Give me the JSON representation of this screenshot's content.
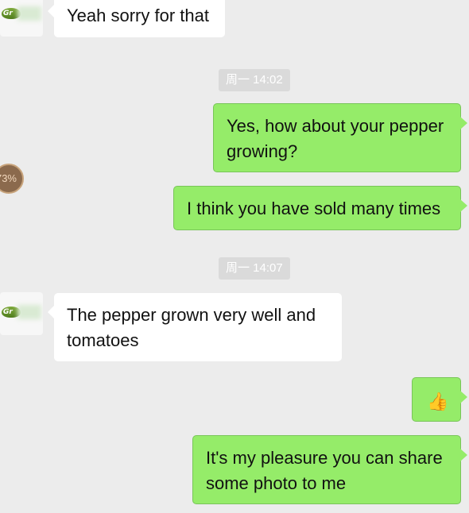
{
  "chat": {
    "messages": [
      {
        "id": "m1",
        "direction": "incoming",
        "text": "Yeah sorry for that"
      },
      {
        "id": "t1",
        "type": "timestamp",
        "text": "周一 14:02"
      },
      {
        "id": "m2",
        "direction": "outgoing",
        "text": "Yes, how about your pepper growing?"
      },
      {
        "id": "m3",
        "direction": "outgoing",
        "text": "I think you have sold many times"
      },
      {
        "id": "t2",
        "type": "timestamp",
        "text": "周一 14:07"
      },
      {
        "id": "m4",
        "direction": "incoming",
        "text": "The pepper grown very well and tomatoes"
      },
      {
        "id": "m5",
        "direction": "outgoing",
        "emoji": "👍"
      },
      {
        "id": "m6",
        "direction": "outgoing",
        "text": "It's my pleasure you can share some photo to me"
      }
    ]
  },
  "overlay": {
    "progress_text": "73%"
  },
  "avatar": {
    "logo_text": "Gr"
  },
  "colors": {
    "background": "#ececec",
    "incoming_bubble": "#ffffff",
    "outgoing_bubble": "#95ec69",
    "timestamp_bg": "#dadada"
  }
}
